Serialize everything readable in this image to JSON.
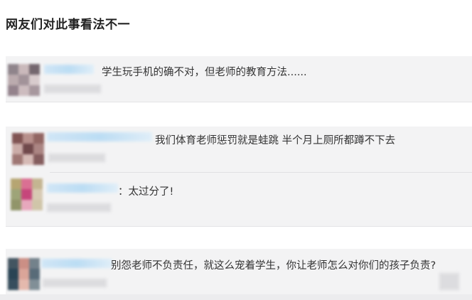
{
  "header": {
    "title": "网友们对此事看法不一"
  },
  "comments": [
    {
      "text": "学生玩手机的确不对，但老师的教育方法......",
      "avatar_colors": [
        "#8a7f86",
        "#c8b6b8",
        "#6e6068",
        "#b9a8ab",
        "#9e8e95",
        "#d7c9cb",
        "#8f7d87",
        "#cbbabd",
        "#a3939a"
      ]
    },
    {
      "text": "我们体育老师惩罚就是蛙跳   半个月上厕所都蹲不下去",
      "avatar_colors": [
        "#7a4b4a",
        "#b48a86",
        "#8d5f5c",
        "#c9a9a4",
        "#6a4043",
        "#a8807d",
        "#9b716e",
        "#d4b7b2",
        "#7f5556"
      ]
    },
    {
      "text": "：太过分了!",
      "avatar_colors": [
        "#b3a16c",
        "#d96a8e",
        "#c2b28c",
        "#9aa072",
        "#c43d75",
        "#d6c8b0",
        "#8c9063",
        "#e7a5bb",
        "#cfc3a6"
      ]
    },
    {
      "text": "别怨老师不负责任，就这么宠着学生，你让老师怎么对你们的孩子负责?",
      "avatar_colors": [
        "#3a4d5a",
        "#c98a80",
        "#6d7c86",
        "#1f3b4c",
        "#d9a195",
        "#506472",
        "#2d4655",
        "#e4b6aa",
        "#7b8a93"
      ]
    }
  ]
}
